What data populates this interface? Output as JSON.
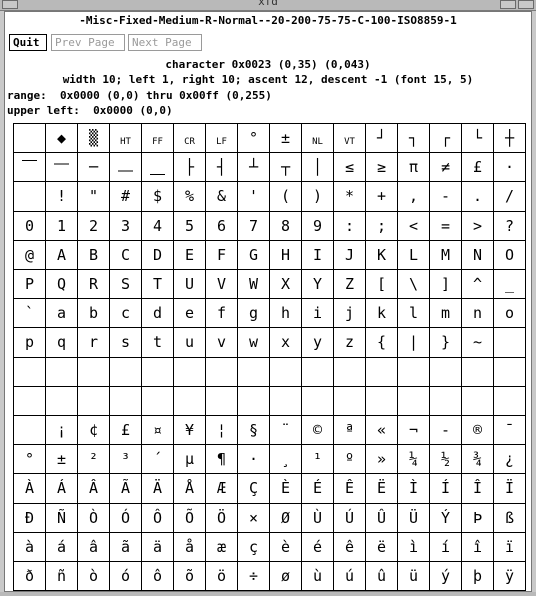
{
  "window": {
    "title": "xfd"
  },
  "font_name": "-Misc-Fixed-Medium-R-Normal--20-200-75-75-C-100-ISO8859-1",
  "buttons": {
    "quit": "Quit",
    "prev": "Prev Page",
    "next": "Next Page"
  },
  "info": {
    "character": "character 0x0023 (0,35) (0,043)",
    "metrics": "width 10; left 1, right 10; ascent 12, descent -1 (font 15, 5)",
    "range": "range:  0x0000 (0,0) thru 0x00ff (0,255)",
    "upper_left": "upper left:  0x0000 (0,0)"
  },
  "grid": {
    "rows": [
      [
        "",
        "◆",
        "▒",
        "HT",
        "FF",
        "CR",
        "LF",
        "°",
        "±",
        "NL",
        "VT",
        "┘",
        "┐",
        "┌",
        "└",
        "┼"
      ],
      [
        "⎺",
        "⎻",
        "─",
        "⎼",
        "⎽",
        "├",
        "┤",
        "┴",
        "┬",
        "│",
        "≤",
        "≥",
        "π",
        "≠",
        "£",
        "·"
      ],
      [
        "",
        "!",
        "\"",
        "#",
        "$",
        "%",
        "&",
        "'",
        "(",
        ")",
        "*",
        "+",
        ",",
        "-",
        ".",
        "/"
      ],
      [
        "0",
        "1",
        "2",
        "3",
        "4",
        "5",
        "6",
        "7",
        "8",
        "9",
        ":",
        ";",
        "<",
        "=",
        ">",
        "?"
      ],
      [
        "@",
        "A",
        "B",
        "C",
        "D",
        "E",
        "F",
        "G",
        "H",
        "I",
        "J",
        "K",
        "L",
        "M",
        "N",
        "O"
      ],
      [
        "P",
        "Q",
        "R",
        "S",
        "T",
        "U",
        "V",
        "W",
        "X",
        "Y",
        "Z",
        "[",
        "\\",
        "]",
        "^",
        "_"
      ],
      [
        "`",
        "a",
        "b",
        "c",
        "d",
        "e",
        "f",
        "g",
        "h",
        "i",
        "j",
        "k",
        "l",
        "m",
        "n",
        "o"
      ],
      [
        "p",
        "q",
        "r",
        "s",
        "t",
        "u",
        "v",
        "w",
        "x",
        "y",
        "z",
        "{",
        "|",
        "}",
        "~",
        ""
      ],
      [
        "",
        "",
        "",
        "",
        "",
        "",
        "",
        "",
        "",
        "",
        "",
        "",
        "",
        "",
        "",
        ""
      ],
      [
        "",
        "",
        "",
        "",
        "",
        "",
        "",
        "",
        "",
        "",
        "",
        "",
        "",
        "",
        "",
        ""
      ],
      [
        "",
        "¡",
        "¢",
        "£",
        "¤",
        "¥",
        "¦",
        "§",
        "¨",
        "©",
        "ª",
        "«",
        "¬",
        "-",
        "®",
        "¯"
      ],
      [
        "°",
        "±",
        "²",
        "³",
        "´",
        "µ",
        "¶",
        "·",
        "¸",
        "¹",
        "º",
        "»",
        "¼",
        "½",
        "¾",
        "¿"
      ],
      [
        "À",
        "Á",
        "Â",
        "Ã",
        "Ä",
        "Å",
        "Æ",
        "Ç",
        "È",
        "É",
        "Ê",
        "Ë",
        "Ì",
        "Í",
        "Î",
        "Ï"
      ],
      [
        "Ð",
        "Ñ",
        "Ò",
        "Ó",
        "Ô",
        "Õ",
        "Ö",
        "×",
        "Ø",
        "Ù",
        "Ú",
        "Û",
        "Ü",
        "Ý",
        "Þ",
        "ß"
      ],
      [
        "à",
        "á",
        "â",
        "ã",
        "ä",
        "å",
        "æ",
        "ç",
        "è",
        "é",
        "ê",
        "ë",
        "ì",
        "í",
        "î",
        "ï"
      ],
      [
        "ð",
        "ñ",
        "ò",
        "ó",
        "ô",
        "õ",
        "ö",
        "÷",
        "ø",
        "ù",
        "ú",
        "û",
        "ü",
        "ý",
        "þ",
        "ÿ"
      ]
    ]
  }
}
